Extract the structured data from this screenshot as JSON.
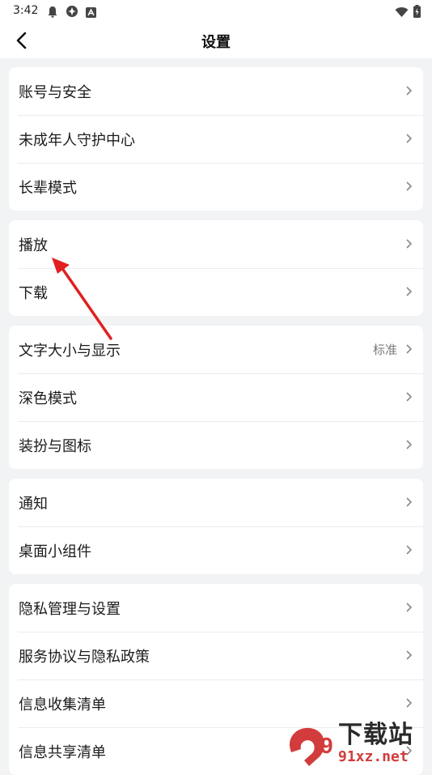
{
  "status_bar": {
    "time": "3:42"
  },
  "header": {
    "title": "设置"
  },
  "groups": [
    {
      "items": [
        {
          "label": "账号与安全"
        },
        {
          "label": "未成年人守护中心"
        },
        {
          "label": "长辈模式"
        }
      ]
    },
    {
      "items": [
        {
          "label": "播放"
        },
        {
          "label": "下载"
        }
      ]
    },
    {
      "items": [
        {
          "label": "文字大小与显示",
          "value": "标准"
        },
        {
          "label": "深色模式"
        },
        {
          "label": "装扮与图标"
        }
      ]
    },
    {
      "items": [
        {
          "label": "通知"
        },
        {
          "label": "桌面小组件"
        }
      ]
    },
    {
      "items": [
        {
          "label": "隐私管理与设置"
        },
        {
          "label": "服务协议与隐私政策"
        },
        {
          "label": "信息收集清单"
        },
        {
          "label": "信息共享清单"
        }
      ]
    }
  ],
  "watermark": {
    "logo_text": "9",
    "top": "下载站",
    "bottom": "91xz.net"
  },
  "colors": {
    "background": "#f2f3f5",
    "card": "#ffffff",
    "annotation_arrow": "#e02020",
    "watermark_red": "#d23c3c"
  }
}
